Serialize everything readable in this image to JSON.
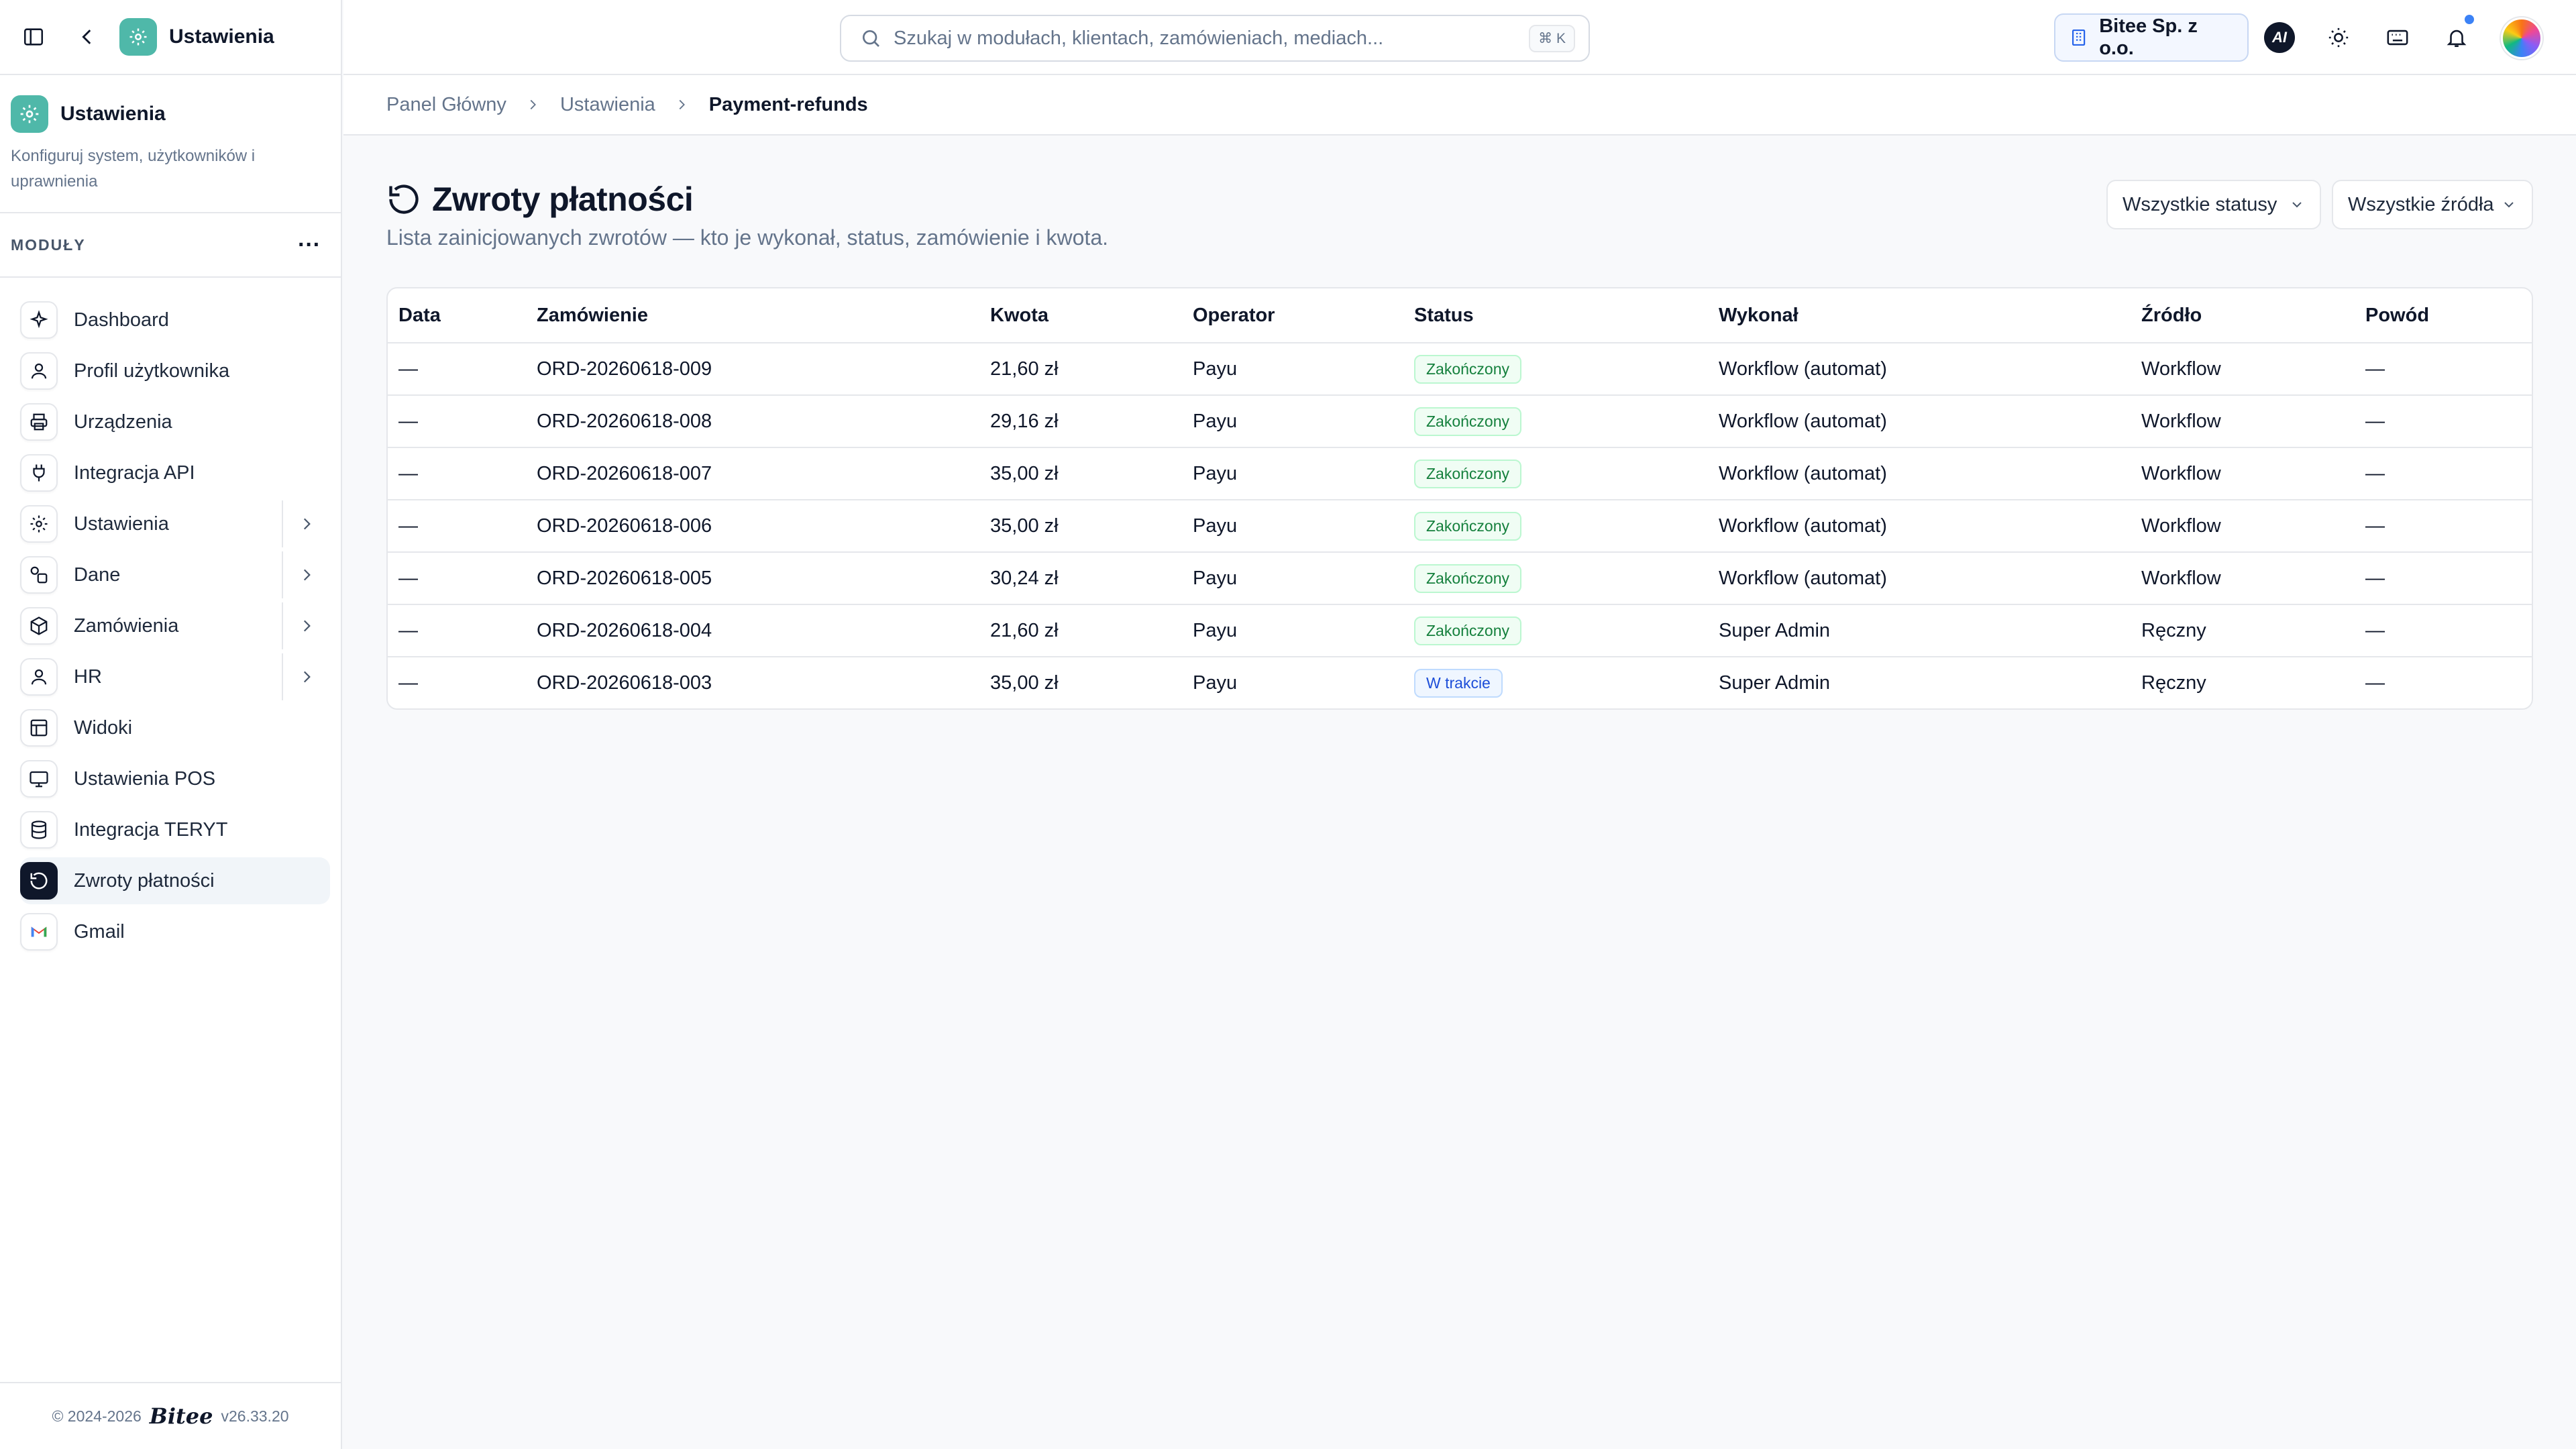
{
  "sidebar": {
    "top_title": "Ustawienia",
    "module": {
      "name": "Ustawienia",
      "description": "Konfiguruj system, użytkowników i uprawnienia"
    },
    "section_label": "MODUŁY",
    "items": [
      {
        "label": "Dashboard",
        "icon": "sparkles-icon",
        "chevron": false,
        "active": false
      },
      {
        "label": "Profil użytkownika",
        "icon": "user-icon",
        "chevron": false,
        "active": false
      },
      {
        "label": "Urządzenia",
        "icon": "printer-icon",
        "chevron": false,
        "active": false
      },
      {
        "label": "Integracja API",
        "icon": "plug-icon",
        "chevron": false,
        "active": false
      },
      {
        "label": "Ustawienia",
        "icon": "gear-icon",
        "chevron": true,
        "active": false
      },
      {
        "label": "Dane",
        "icon": "data-icon",
        "chevron": true,
        "active": false
      },
      {
        "label": "Zamówienia",
        "icon": "box-icon",
        "chevron": true,
        "active": false
      },
      {
        "label": "HR",
        "icon": "user-icon",
        "chevron": true,
        "active": false
      },
      {
        "label": "Widoki",
        "icon": "layout-icon",
        "chevron": false,
        "active": false
      },
      {
        "label": "Ustawienia POS",
        "icon": "monitor-icon",
        "chevron": false,
        "active": false
      },
      {
        "label": "Integracja TERYT",
        "icon": "database-icon",
        "chevron": false,
        "active": false
      },
      {
        "label": "Zwroty płatności",
        "icon": "refund-icon",
        "chevron": false,
        "active": true
      },
      {
        "label": "Gmail",
        "icon": "gmail-icon",
        "chevron": false,
        "active": false
      }
    ],
    "footer": {
      "copyright": "© 2024-2026",
      "logo": "Bitee",
      "version": "v26.33.20"
    }
  },
  "topbar": {
    "search_placeholder": "Szukaj w modułach, klientach, zamówieniach, mediach...",
    "search_shortcut": "⌘ K",
    "company": "Bitee Sp. z o.o.",
    "ai_label": "AI"
  },
  "breadcrumb": [
    "Panel Główny",
    "Ustawienia",
    "Payment-refunds"
  ],
  "page": {
    "title": "Zwroty płatności",
    "subtitle": "Lista zainicjowanych zwrotów — kto je wykonał, status, zamówienie i kwota.",
    "filter_status": "Wszystkie statusy",
    "filter_source": "Wszystkie źródła"
  },
  "table": {
    "columns": [
      "Data",
      "Zamówienie",
      "Kwota",
      "Operator",
      "Status",
      "Wykonał",
      "Źródło",
      "Powód"
    ],
    "rows": [
      {
        "date": "—",
        "order": "ORD-20260618-009",
        "amount": "21,60 zł",
        "operator": "Payu",
        "status": "Zakończony",
        "status_type": "done",
        "executed_by": "Workflow (automat)",
        "source": "Workflow",
        "reason": "—"
      },
      {
        "date": "—",
        "order": "ORD-20260618-008",
        "amount": "29,16 zł",
        "operator": "Payu",
        "status": "Zakończony",
        "status_type": "done",
        "executed_by": "Workflow (automat)",
        "source": "Workflow",
        "reason": "—"
      },
      {
        "date": "—",
        "order": "ORD-20260618-007",
        "amount": "35,00 zł",
        "operator": "Payu",
        "status": "Zakończony",
        "status_type": "done",
        "executed_by": "Workflow (automat)",
        "source": "Workflow",
        "reason": "—"
      },
      {
        "date": "—",
        "order": "ORD-20260618-006",
        "amount": "35,00 zł",
        "operator": "Payu",
        "status": "Zakończony",
        "status_type": "done",
        "executed_by": "Workflow (automat)",
        "source": "Workflow",
        "reason": "—"
      },
      {
        "date": "—",
        "order": "ORD-20260618-005",
        "amount": "30,24 zł",
        "operator": "Payu",
        "status": "Zakończony",
        "status_type": "done",
        "executed_by": "Workflow (automat)",
        "source": "Workflow",
        "reason": "—"
      },
      {
        "date": "—",
        "order": "ORD-20260618-004",
        "amount": "21,60 zł",
        "operator": "Payu",
        "status": "Zakończony",
        "status_type": "done",
        "executed_by": "Super Admin",
        "source": "Ręczny",
        "reason": "—"
      },
      {
        "date": "—",
        "order": "ORD-20260618-003",
        "amount": "35,00 zł",
        "operator": "Payu",
        "status": "W trakcie",
        "status_type": "progress",
        "executed_by": "Super Admin",
        "source": "Ręczny",
        "reason": "—"
      }
    ]
  },
  "colors": {
    "accent": "#4fb8a9",
    "status_done": "#15803d",
    "status_progress": "#1d4ed8",
    "notification_dot": "#3b82f6"
  }
}
